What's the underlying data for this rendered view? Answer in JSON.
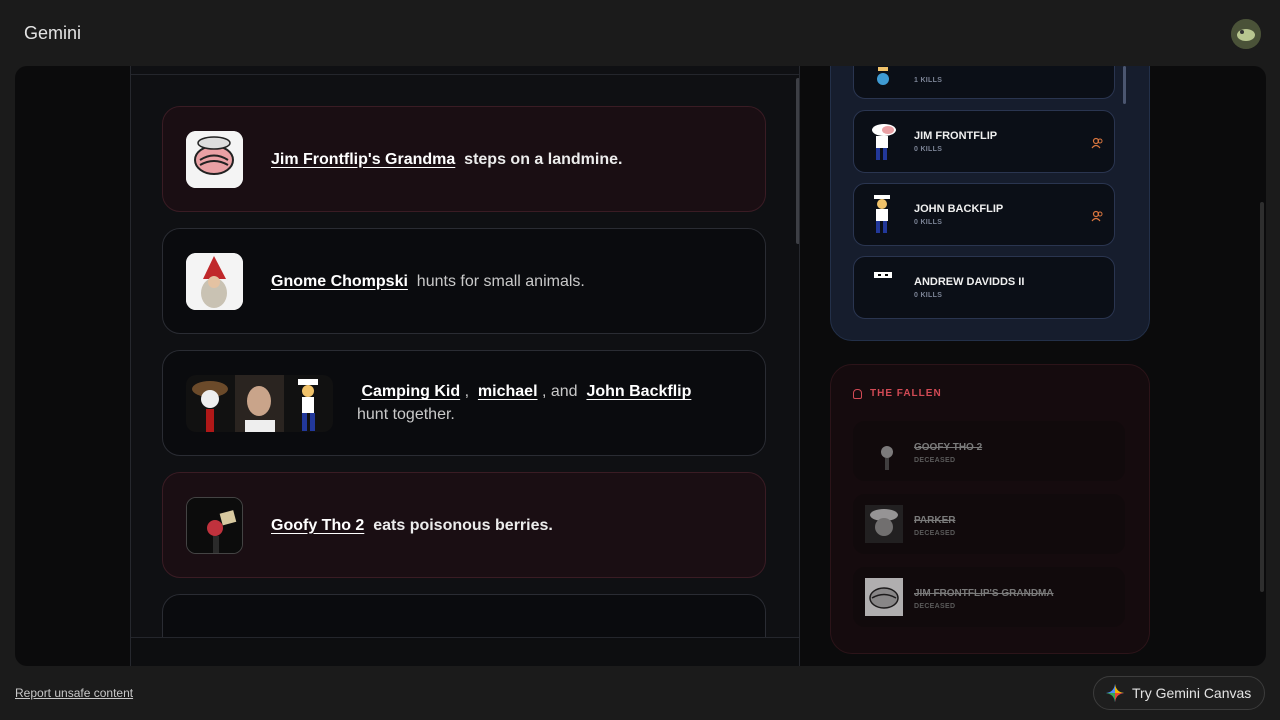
{
  "app": {
    "title": "Gemini"
  },
  "feed": {
    "events": [
      {
        "name": "Jim Frontflip's Grandma",
        "action": "steps on a landmine.",
        "style": "death"
      },
      {
        "name": "Gnome Chompski",
        "action": "hunts for small animals.",
        "style": "normal"
      },
      {
        "names": [
          "Camping Kid",
          "michael",
          "John Backflip"
        ],
        "sep1": ",",
        "sep2": ", and",
        "action": "hunt together.",
        "style": "normal"
      },
      {
        "name": "Goofy Tho 2",
        "action": "eats poisonous berries.",
        "style": "death"
      }
    ]
  },
  "alive": [
    {
      "name": "",
      "kills": "1 KILLS"
    },
    {
      "name": "JIM FRONTFLIP",
      "kills": "0 KILLS",
      "icon": "alliance-icon"
    },
    {
      "name": "JOHN BACKFLIP",
      "kills": "0 KILLS",
      "icon": "alliance-icon"
    },
    {
      "name": "ANDREW DAVIDDS II",
      "kills": "0 KILLS"
    }
  ],
  "fallen": {
    "title": "THE FALLEN",
    "items": [
      {
        "name": "GOOFY THO 2",
        "status": "DECEASED"
      },
      {
        "name": "PARKER",
        "status": "DECEASED"
      },
      {
        "name": "JIM FRONTFLIP'S GRANDMA",
        "status": "DECEASED"
      }
    ]
  },
  "footer": {
    "report": "Report unsafe content",
    "canvas_button": "Try Gemini Canvas"
  },
  "colors": {
    "accent_red": "#d24a55",
    "alliance_orange": "#d9763f",
    "panel_blue": "#161d2d"
  }
}
